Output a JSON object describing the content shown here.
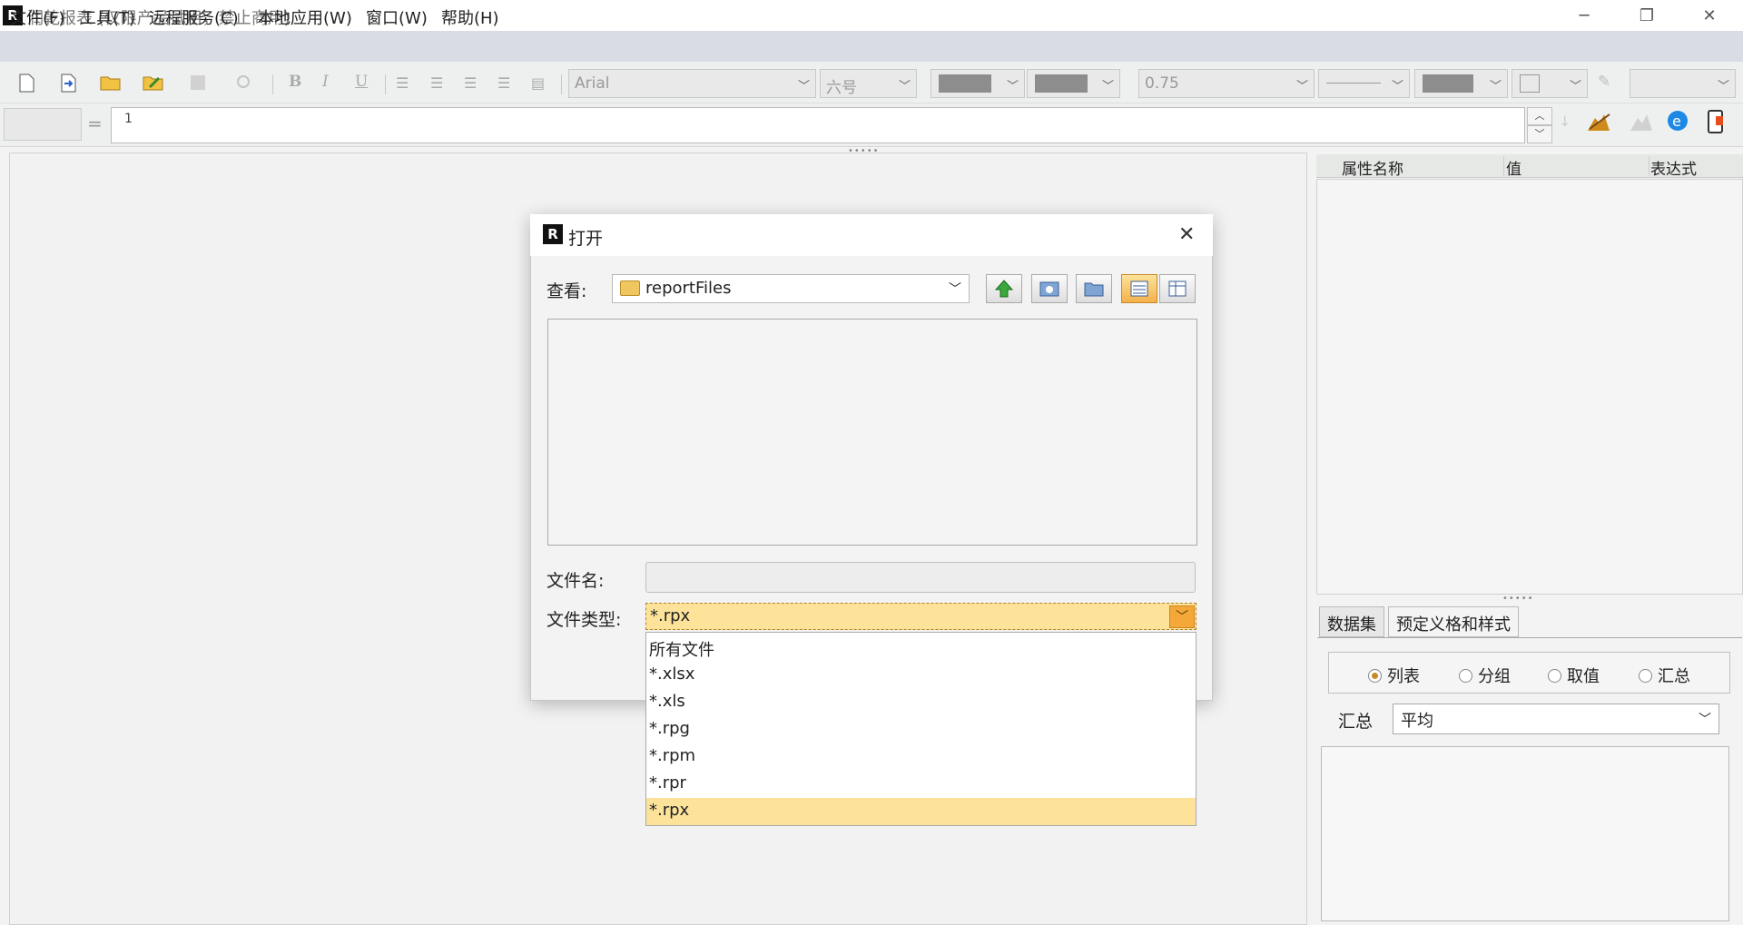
{
  "window": {
    "title": "润乾报表 (仅限产品试用，禁止商用)",
    "icon_letter": "R",
    "minimize_icon": "─",
    "restore_icon": "❐",
    "close_icon": "✕"
  },
  "menu": [
    "文件(F)",
    "工具(T)",
    "远程服务(C)",
    "本地应用(W)",
    "窗口(W)",
    "帮助(H)"
  ],
  "toolbar": {
    "font_family": "Arial",
    "font_size": "六号",
    "line_width": "0.75",
    "bold": "B",
    "italic": "I",
    "underline": "U"
  },
  "formula": {
    "cell_ref": "",
    "eq": "=",
    "value": "1",
    "spin_up": "︿",
    "spin_down": "﹀"
  },
  "properties": {
    "col_name": "属性名称",
    "col_value": "值",
    "col_expr": "表达式"
  },
  "panel_tabs": [
    "数据集",
    "预定义格和样式"
  ],
  "radio_options": [
    {
      "label": "列表",
      "checked": true
    },
    {
      "label": "分组",
      "checked": false
    },
    {
      "label": "取值",
      "checked": false
    },
    {
      "label": "汇总",
      "checked": false
    }
  ],
  "aggregate": {
    "label": "汇总",
    "value": "平均"
  },
  "dialog": {
    "title": "打开",
    "look_in_label": "查看:",
    "look_in_value": "reportFiles",
    "filename_label": "文件名:",
    "filename_value": "",
    "filetype_label": "文件类型:",
    "filetype_value": "*.rpx",
    "close_icon": "✕",
    "filetype_options": [
      "所有文件",
      "*.xlsx",
      "*.xls",
      "*.rpg",
      "*.rpm",
      "*.rpr",
      "*.rpx"
    ],
    "selected_option_index": 6
  },
  "colors": {
    "accent_select": "#fde39a",
    "menu_bg": "#d9dde3"
  }
}
